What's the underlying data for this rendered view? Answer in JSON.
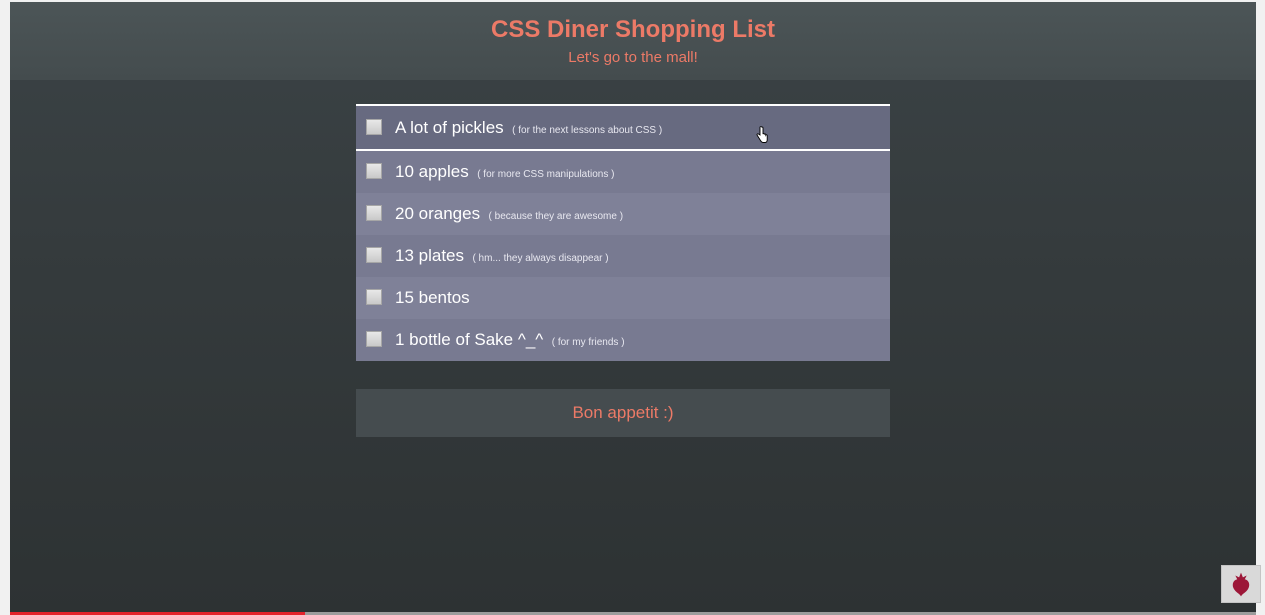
{
  "header": {
    "title": "CSS Diner Shopping List",
    "subtitle": "Let's go to the mall!"
  },
  "list": {
    "items": [
      {
        "name": "A lot of pickles",
        "note": "( for the next lessons about CSS )",
        "checked": false
      },
      {
        "name": "10 apples",
        "note": "( for more CSS manipulations )",
        "checked": false
      },
      {
        "name": "20 oranges",
        "note": "( because they are awesome )",
        "checked": false
      },
      {
        "name": "13 plates",
        "note": "( hm... they always disappear )",
        "checked": false
      },
      {
        "name": "15 bentos",
        "note": "",
        "checked": false
      },
      {
        "name": "1 bottle of Sake ^_^",
        "note": "( for my friends )",
        "checked": false
      }
    ]
  },
  "footer": {
    "text": "Bon appetit :)"
  },
  "video": {
    "progress": 0.237
  },
  "colors": {
    "accent": "#ec7a67",
    "item": "#787a91",
    "item_highlighted": "#676a80",
    "background": "#353b3d",
    "progress": "#e3232c"
  },
  "icons": {
    "cursor": "hand-pointer-icon",
    "badge": "beet-logo-icon"
  }
}
